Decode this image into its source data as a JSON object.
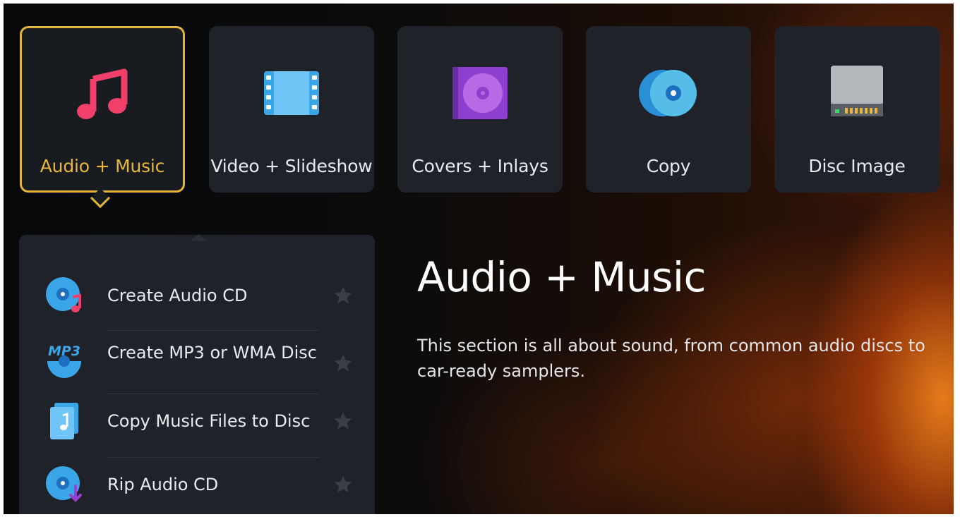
{
  "categories": [
    {
      "label": "Audio + Music",
      "icon": "music-note-icon",
      "selected": true
    },
    {
      "label": "Video + Slideshow",
      "icon": "film-strip-icon",
      "selected": false
    },
    {
      "label": "Covers + Inlays",
      "icon": "disc-cover-icon",
      "selected": false
    },
    {
      "label": "Copy",
      "icon": "copy-disc-icon",
      "selected": false
    },
    {
      "label": "Disc Image",
      "icon": "disc-drive-icon",
      "selected": false
    }
  ],
  "menu": {
    "items": [
      {
        "label": "Create Audio CD",
        "icon": "audio-cd-icon"
      },
      {
        "label": "Create MP3 or WMA Disc",
        "icon": "mp3-disc-icon",
        "badge": "MP3"
      },
      {
        "label": "Copy Music Files to Disc",
        "icon": "music-files-icon"
      },
      {
        "label": "Rip Audio CD",
        "icon": "rip-cd-icon"
      }
    ]
  },
  "detail": {
    "title": "Audio + Music",
    "description": "This section is all about sound, from common audio discs to car-ready samplers."
  },
  "colors": {
    "selected_accent": "#e2b53a",
    "tile_bg": "#1f2329",
    "music_icon": "#f0406a"
  }
}
